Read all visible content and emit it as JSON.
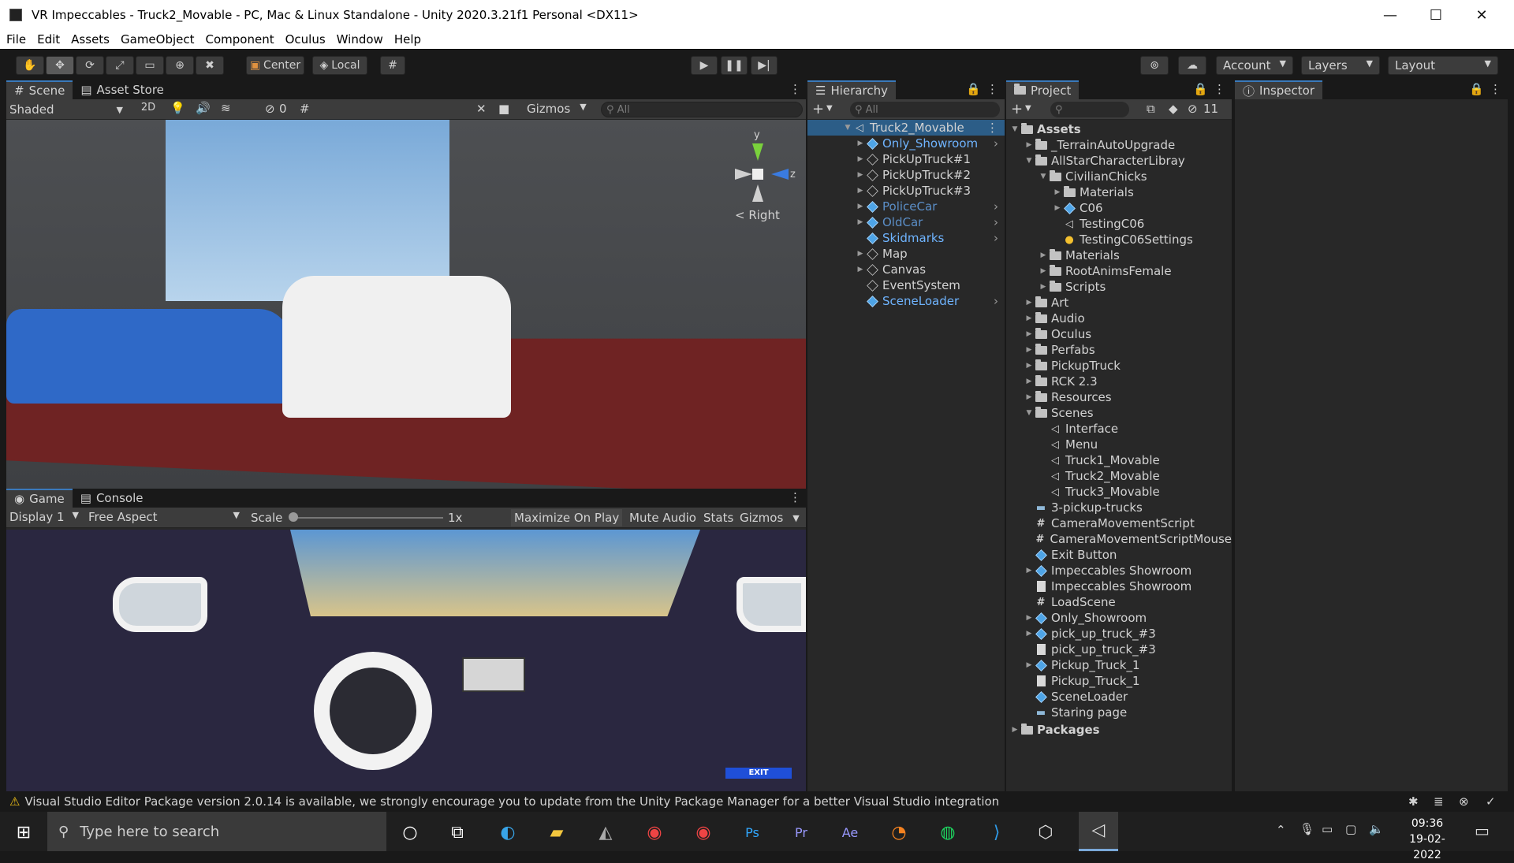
{
  "window": {
    "title": "VR Impeccables - Truck2_Movable - PC, Mac & Linux Standalone - Unity 2020.3.21f1 Personal <DX11>"
  },
  "menu": [
    "File",
    "Edit",
    "Assets",
    "GameObject",
    "Component",
    "Oculus",
    "Window",
    "Help"
  ],
  "toolbar": {
    "pivot_center": "Center",
    "pivot_local": "Local",
    "account": "Account",
    "layers": "Layers",
    "layout": "Layout"
  },
  "scene_panel": {
    "tabs": [
      "Scene",
      "Asset Store"
    ],
    "shading": "Shaded",
    "mode_2d": "2D",
    "hidden_count": "0",
    "gizmos": "Gizmos",
    "search_placeholder": "All",
    "gizmo_axis_y": "y",
    "gizmo_axis_z": "z",
    "view_label": "Right"
  },
  "game_panel": {
    "tabs": [
      "Game",
      "Console"
    ],
    "display": "Display 1",
    "aspect": "Free Aspect",
    "scale_label": "Scale",
    "scale_value": "1x",
    "maximize": "Maximize On Play",
    "mute": "Mute Audio",
    "stats": "Stats",
    "gizmos": "Gizmos",
    "exit_label": "EXIT"
  },
  "hierarchy": {
    "tab": "Hierarchy",
    "search_placeholder": "All",
    "scene": "Truck2_Movable",
    "items": [
      {
        "label": "Only_Showroom",
        "style": "blue"
      },
      {
        "label": "PickUpTruck#1",
        "style": "normal"
      },
      {
        "label": "PickUpTruck#2",
        "style": "normal"
      },
      {
        "label": "PickUpTruck#3",
        "style": "normal"
      },
      {
        "label": "PoliceCar",
        "style": "dim"
      },
      {
        "label": "OldCar",
        "style": "dim"
      },
      {
        "label": "Skidmarks",
        "style": "blue"
      },
      {
        "label": "Map",
        "style": "normal"
      },
      {
        "label": "Canvas",
        "style": "normal"
      },
      {
        "label": "EventSystem",
        "style": "normal"
      },
      {
        "label": "SceneLoader",
        "style": "blue"
      }
    ]
  },
  "project": {
    "tab": "Project",
    "hidden_count": "11",
    "assets_root": "Assets",
    "items": [
      {
        "label": "_TerrainAutoUpgrade",
        "indent": 1,
        "icon": "folder"
      },
      {
        "label": "AllStarCharacterLibray",
        "indent": 1,
        "icon": "folder-open"
      },
      {
        "label": "CivilianChicks",
        "indent": 2,
        "icon": "folder-open"
      },
      {
        "label": "Materials",
        "indent": 3,
        "icon": "folder"
      },
      {
        "label": "C06",
        "indent": 3,
        "icon": "prefab"
      },
      {
        "label": "TestingC06",
        "indent": 3,
        "icon": "scene"
      },
      {
        "label": "TestingC06Settings",
        "indent": 3,
        "icon": "settings"
      },
      {
        "label": "Materials",
        "indent": 2,
        "icon": "folder"
      },
      {
        "label": "RootAnimsFemale",
        "indent": 2,
        "icon": "folder"
      },
      {
        "label": "Scripts",
        "indent": 2,
        "icon": "folder"
      },
      {
        "label": "Art",
        "indent": 1,
        "icon": "folder"
      },
      {
        "label": "Audio",
        "indent": 1,
        "icon": "folder"
      },
      {
        "label": "Oculus",
        "indent": 1,
        "icon": "folder"
      },
      {
        "label": "Perfabs",
        "indent": 1,
        "icon": "folder"
      },
      {
        "label": "PickupTruck",
        "indent": 1,
        "icon": "folder"
      },
      {
        "label": "RCK 2.3",
        "indent": 1,
        "icon": "folder"
      },
      {
        "label": "Resources",
        "indent": 1,
        "icon": "folder"
      },
      {
        "label": "Scenes",
        "indent": 1,
        "icon": "folder-open"
      },
      {
        "label": "Interface",
        "indent": 2,
        "icon": "scene"
      },
      {
        "label": "Menu",
        "indent": 2,
        "icon": "scene"
      },
      {
        "label": "Truck1_Movable",
        "indent": 2,
        "icon": "scene"
      },
      {
        "label": "Truck2_Movable",
        "indent": 2,
        "icon": "scene"
      },
      {
        "label": "Truck3_Movable",
        "indent": 2,
        "icon": "scene"
      },
      {
        "label": "3-pickup-trucks",
        "indent": 1,
        "icon": "model"
      },
      {
        "label": "CameraMovementScript",
        "indent": 1,
        "icon": "script"
      },
      {
        "label": "CameraMovementScriptMouse",
        "indent": 1,
        "icon": "script"
      },
      {
        "label": "Exit Button",
        "indent": 1,
        "icon": "cube"
      },
      {
        "label": "Impeccables Showroom",
        "indent": 1,
        "icon": "prefab"
      },
      {
        "label": "Impeccables Showroom",
        "indent": 1,
        "icon": "doc"
      },
      {
        "label": "LoadScene",
        "indent": 1,
        "icon": "script"
      },
      {
        "label": "Only_Showroom",
        "indent": 1,
        "icon": "prefab"
      },
      {
        "label": "pick_up_truck_#3",
        "indent": 1,
        "icon": "prefab"
      },
      {
        "label": "pick_up_truck_#3",
        "indent": 1,
        "icon": "doc"
      },
      {
        "label": "Pickup_Truck_1",
        "indent": 1,
        "icon": "prefab"
      },
      {
        "label": "Pickup_Truck_1",
        "indent": 1,
        "icon": "doc"
      },
      {
        "label": "SceneLoader",
        "indent": 1,
        "icon": "cube"
      },
      {
        "label": "Staring page",
        "indent": 1,
        "icon": "model"
      }
    ],
    "packages": "Packages"
  },
  "inspector": {
    "tab": "Inspector"
  },
  "status": {
    "message": "Visual Studio Editor Package version 2.0.14 is available, we strongly encourage you to update from the Unity Package Manager for a better Visual Studio integration"
  },
  "taskbar": {
    "search_placeholder": "Type here to search",
    "time": "09:36",
    "date": "19-02-2022"
  },
  "colors": {
    "accent": "#3a79bb",
    "panel": "#282828",
    "selection": "#2c5d87",
    "warning": "#f5c518"
  }
}
